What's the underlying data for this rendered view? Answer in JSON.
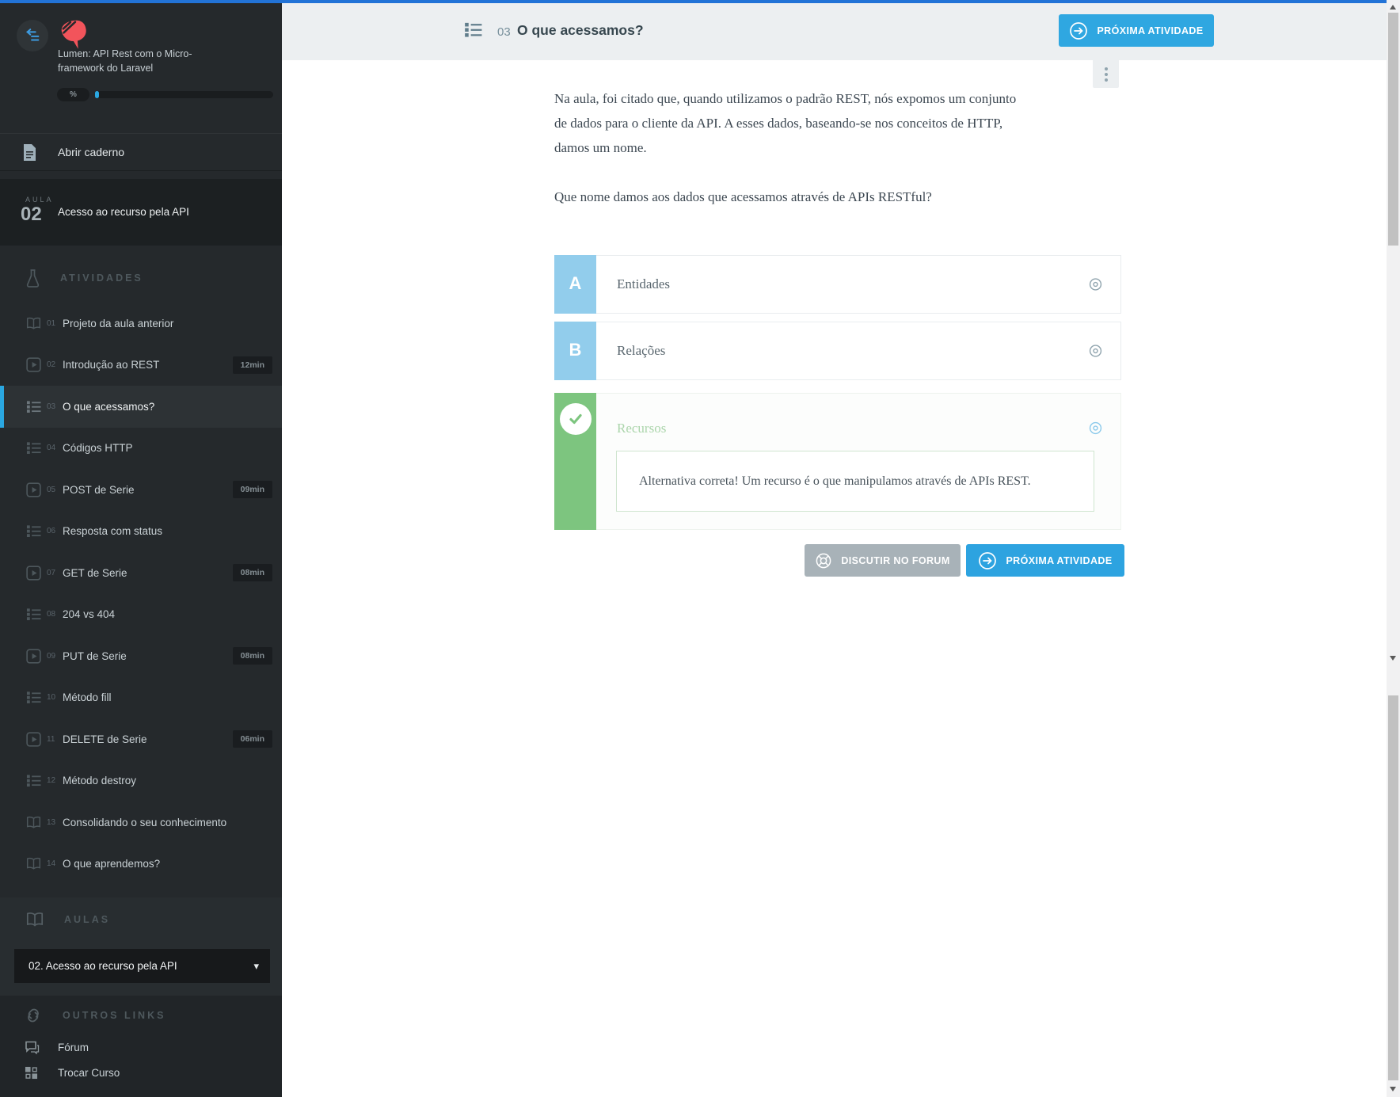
{
  "sidebar": {
    "course_title": "Lumen: API Rest com o Micro-framework do Laravel",
    "progress_percent_label": "%",
    "open_notebook": "Abrir caderno",
    "lesson": {
      "label": "AULA",
      "number": "02",
      "title": "Acesso ao recurso pela API"
    },
    "activities_header": "ATIVIDADES",
    "activities": [
      {
        "num": "01",
        "label": "Projeto da aula anterior"
      },
      {
        "num": "02",
        "label": "Introdução ao REST",
        "duration": "12min"
      },
      {
        "num": "03",
        "label": "O que acessamos?"
      },
      {
        "num": "04",
        "label": "Códigos HTTP"
      },
      {
        "num": "05",
        "label": "POST de Serie",
        "duration": "09min"
      },
      {
        "num": "06",
        "label": "Resposta com status"
      },
      {
        "num": "07",
        "label": "GET de Serie",
        "duration": "08min"
      },
      {
        "num": "08",
        "label": "204 vs 404"
      },
      {
        "num": "09",
        "label": "PUT de Serie",
        "duration": "08min"
      },
      {
        "num": "10",
        "label": "Método fill"
      },
      {
        "num": "11",
        "label": "DELETE de Serie",
        "duration": "06min"
      },
      {
        "num": "12",
        "label": "Método destroy"
      },
      {
        "num": "13",
        "label": "Consolidando o seu conhecimento"
      },
      {
        "num": "14",
        "label": "O que aprendemos?"
      }
    ],
    "aulas_header": "AULAS",
    "aulas_selected": "02. Acesso ao recurso pela API",
    "other_links_header": "OUTROS LINKS",
    "forum_label": "Fórum",
    "switch_course_label": "Trocar Curso"
  },
  "header": {
    "activity_number": "03",
    "title": "O que acessamos?",
    "next_button": "PRÓXIMA ATIVIDADE"
  },
  "question": {
    "paragraph": "Na aula, foi citado que, quando utilizamos o padrão REST, nós expomos um conjunto de dados para o cliente da API. A esses dados, baseando-se nos conceitos de HTTP, damos um nome.",
    "prompt": "Que nome damos aos dados que acessamos através de APIs RESTful?",
    "options": [
      {
        "letter": "A",
        "text": "Entidades"
      },
      {
        "letter": "B",
        "text": "Relações"
      },
      {
        "letter": "",
        "text": "Recursos",
        "feedback": "Alternativa correta! Um recurso é o que manipulamos através de APIs REST."
      }
    ]
  },
  "footer": {
    "forum_button": "DISCUTIR NO FORUM",
    "next_button": "PRÓXIMA ATIVIDADE"
  },
  "colors": {
    "topbar_blue": "#2273d7",
    "accent_blue": "#2da3e0",
    "option_letter_blue": "#92cdec",
    "correct_green": "#7dc57f",
    "logo_red": "#f2545b",
    "sidebar_bg": "#25292c",
    "header_bg": "#eceff1"
  }
}
